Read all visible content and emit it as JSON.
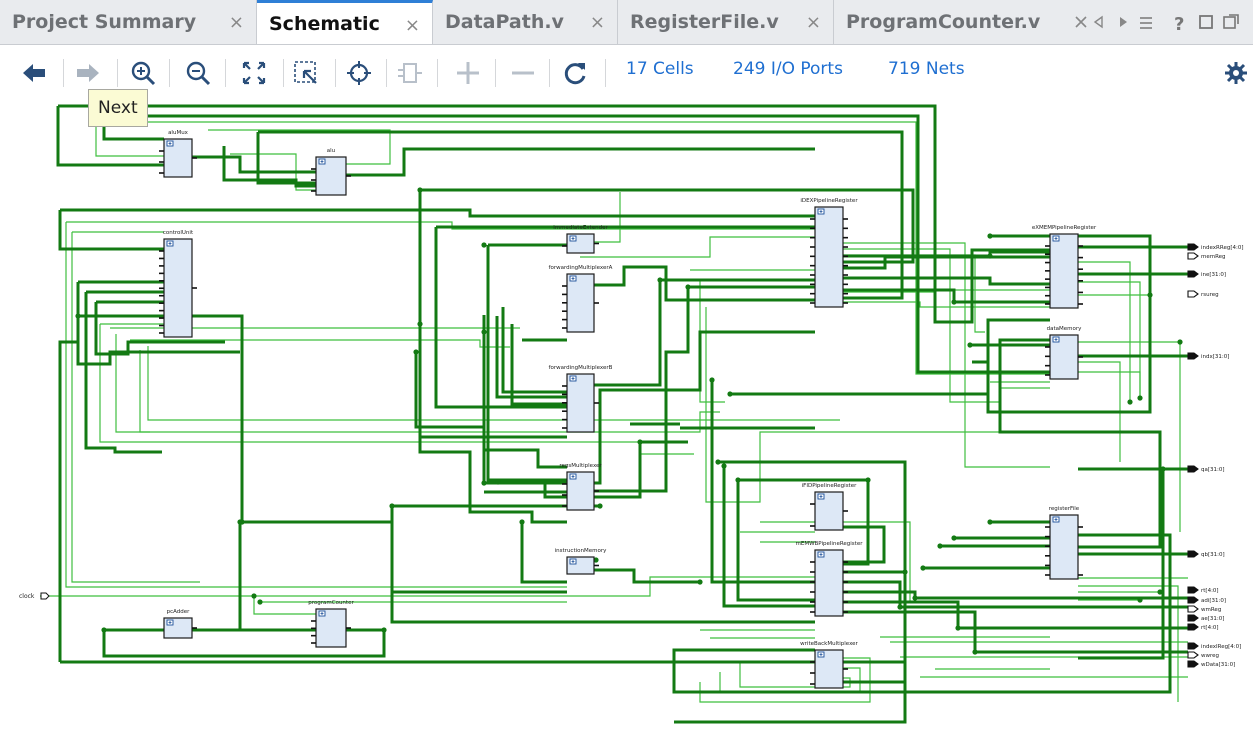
{
  "tabs": [
    {
      "label": "Project Summary",
      "active": false
    },
    {
      "label": "Schematic",
      "active": true
    },
    {
      "label": "DataPath.v",
      "active": false
    },
    {
      "label": "RegisterFile.v",
      "active": false
    },
    {
      "label": "ProgramCounter.v",
      "active": false
    }
  ],
  "tab_close_glyph": "×",
  "toolbar": {
    "stats": {
      "cells": "17 Cells",
      "ports": "249 I/O Ports",
      "nets": "719 Nets"
    },
    "tooltip": "Next",
    "icons": [
      "back-arrow-icon",
      "forward-arrow-icon",
      "zoom-in-icon",
      "zoom-out-icon",
      "zoom-fit-icon",
      "zoom-area-icon",
      "select-icon",
      "cell-icon",
      "add-icon",
      "remove-icon",
      "reload-icon",
      "settings-icon"
    ]
  },
  "schematic": {
    "cells": [
      {
        "name": "aluMux"
      },
      {
        "name": "alu"
      },
      {
        "name": "controlUnit"
      },
      {
        "name": "immediateExtender"
      },
      {
        "name": "forwardingMultiplexerA"
      },
      {
        "name": "forwardingMultiplexerB"
      },
      {
        "name": "regsMultiplexer"
      },
      {
        "name": "instructionMemory"
      },
      {
        "name": "pcAdder"
      },
      {
        "name": "programCounter"
      },
      {
        "name": "iDEXPipelineRegister"
      },
      {
        "name": "eXMEMPipelineRegister"
      },
      {
        "name": "dataMemory"
      },
      {
        "name": "iFIDPipelineRegister"
      },
      {
        "name": "mEMWBPipelineRegister"
      },
      {
        "name": "registerFile"
      },
      {
        "name": "writeBackMultiplexer"
      }
    ],
    "input_ports": [
      {
        "name": "clock"
      }
    ],
    "output_ports": [
      {
        "name": "indexRReg[4:0]"
      },
      {
        "name": "memReg"
      },
      {
        "name": "ine[31:0]"
      },
      {
        "name": "rsureg"
      },
      {
        "name": "indx[31:0]"
      },
      {
        "name": "qa[31:0]"
      },
      {
        "name": "qb[31:0]"
      },
      {
        "name": "rt[4:0]"
      },
      {
        "name": "adi[31:0]"
      },
      {
        "name": "wmReg"
      },
      {
        "name": "ae[31:0]"
      },
      {
        "name": "rt[4:0]"
      },
      {
        "name": "indexIReg[4:0]"
      },
      {
        "name": "wwreg"
      },
      {
        "name": "wData[31:0]"
      }
    ]
  }
}
